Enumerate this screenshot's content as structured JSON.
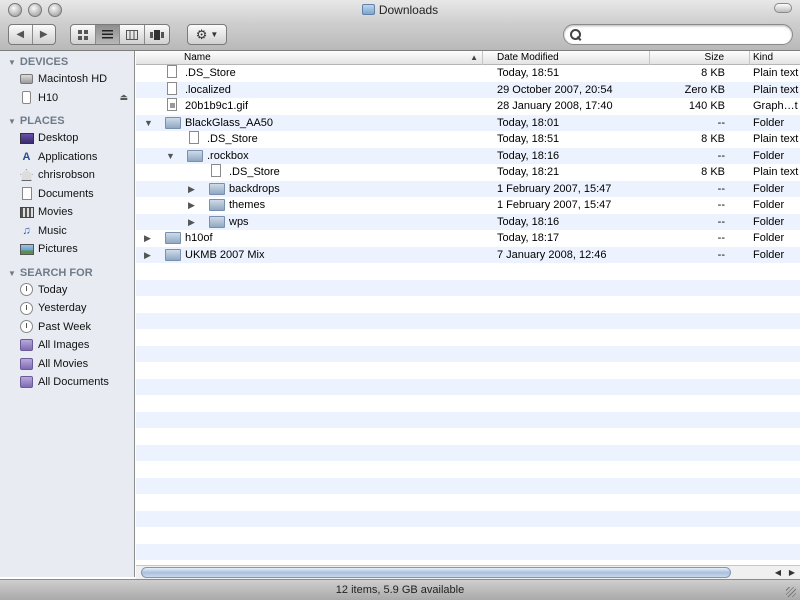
{
  "window": {
    "title": "Downloads"
  },
  "toolbar": {
    "back_icon": "◀",
    "forward_icon": "▶",
    "view_icons": [
      "icon-view-icon",
      "list-view-icon",
      "column-view-icon",
      "coverflow-view-icon"
    ],
    "action_icon": "⚙",
    "search_placeholder": "",
    "search_value": ""
  },
  "sidebar": {
    "sections": [
      {
        "label": "DEVICES",
        "items": [
          {
            "label": "Macintosh HD",
            "icon": "hard-drive-icon"
          },
          {
            "label": "H10",
            "icon": "ipod-icon",
            "eject": "⏏"
          }
        ]
      },
      {
        "label": "PLACES",
        "items": [
          {
            "label": "Desktop",
            "icon": "desktop-icon"
          },
          {
            "label": "Applications",
            "icon": "applications-icon"
          },
          {
            "label": "chrisrobson",
            "icon": "home-icon"
          },
          {
            "label": "Documents",
            "icon": "documents-icon"
          },
          {
            "label": "Movies",
            "icon": "movies-icon"
          },
          {
            "label": "Music",
            "icon": "music-icon"
          },
          {
            "label": "Pictures",
            "icon": "pictures-icon"
          }
        ]
      },
      {
        "label": "SEARCH FOR",
        "items": [
          {
            "label": "Today",
            "icon": "clock-icon"
          },
          {
            "label": "Yesterday",
            "icon": "clock-icon"
          },
          {
            "label": "Past Week",
            "icon": "clock-icon"
          },
          {
            "label": "All Images",
            "icon": "smart-folder-icon"
          },
          {
            "label": "All Movies",
            "icon": "smart-folder-icon"
          },
          {
            "label": "All Documents",
            "icon": "smart-folder-icon"
          }
        ]
      }
    ]
  },
  "columns": {
    "name": "Name",
    "date": "Date Modified",
    "size": "Size",
    "kind": "Kind"
  },
  "files": [
    {
      "name": ".DS_Store",
      "date": "Today, 18:51",
      "size": "8 KB",
      "kind": "Plain text",
      "type": "file",
      "level": 0,
      "disclosure": ""
    },
    {
      "name": ".localized",
      "date": "29 October 2007, 20:54",
      "size": "Zero KB",
      "kind": "Plain text",
      "type": "file",
      "level": 0,
      "disclosure": ""
    },
    {
      "name": "20b1b9c1.gif",
      "date": "28 January 2008, 17:40",
      "size": "140 KB",
      "kind": "Graph…t",
      "type": "gif",
      "level": 0,
      "disclosure": ""
    },
    {
      "name": "BlackGlass_AA50",
      "date": "Today, 18:01",
      "size": "--",
      "kind": "Folder",
      "type": "folder",
      "level": 0,
      "disclosure": "▼"
    },
    {
      "name": ".DS_Store",
      "date": "Today, 18:51",
      "size": "8 KB",
      "kind": "Plain text",
      "type": "file",
      "level": 1,
      "disclosure": ""
    },
    {
      "name": ".rockbox",
      "date": "Today, 18:16",
      "size": "--",
      "kind": "Folder",
      "type": "folder",
      "level": 1,
      "disclosure": "▼"
    },
    {
      "name": ".DS_Store",
      "date": "Today, 18:21",
      "size": "8 KB",
      "kind": "Plain text",
      "type": "file",
      "level": 2,
      "disclosure": ""
    },
    {
      "name": "backdrops",
      "date": "1 February 2007, 15:47",
      "size": "--",
      "kind": "Folder",
      "type": "folder",
      "level": 2,
      "disclosure": "▶"
    },
    {
      "name": "themes",
      "date": "1 February 2007, 15:47",
      "size": "--",
      "kind": "Folder",
      "type": "folder",
      "level": 2,
      "disclosure": "▶"
    },
    {
      "name": "wps",
      "date": "Today, 18:16",
      "size": "--",
      "kind": "Folder",
      "type": "folder",
      "level": 2,
      "disclosure": "▶"
    },
    {
      "name": "h10of",
      "date": "Today, 18:17",
      "size": "--",
      "kind": "Folder",
      "type": "folder",
      "level": 0,
      "disclosure": "▶"
    },
    {
      "name": "UKMB 2007 Mix",
      "date": "7 January 2008, 12:46",
      "size": "--",
      "kind": "Folder",
      "type": "folder",
      "level": 0,
      "disclosure": "▶"
    }
  ],
  "status": {
    "text": "12 items, 5.9 GB available"
  },
  "colors": {
    "sidebar_bg": "#e8ecf2",
    "stripe": "#edf3fe",
    "sidebar_header": "#6f7a89"
  }
}
